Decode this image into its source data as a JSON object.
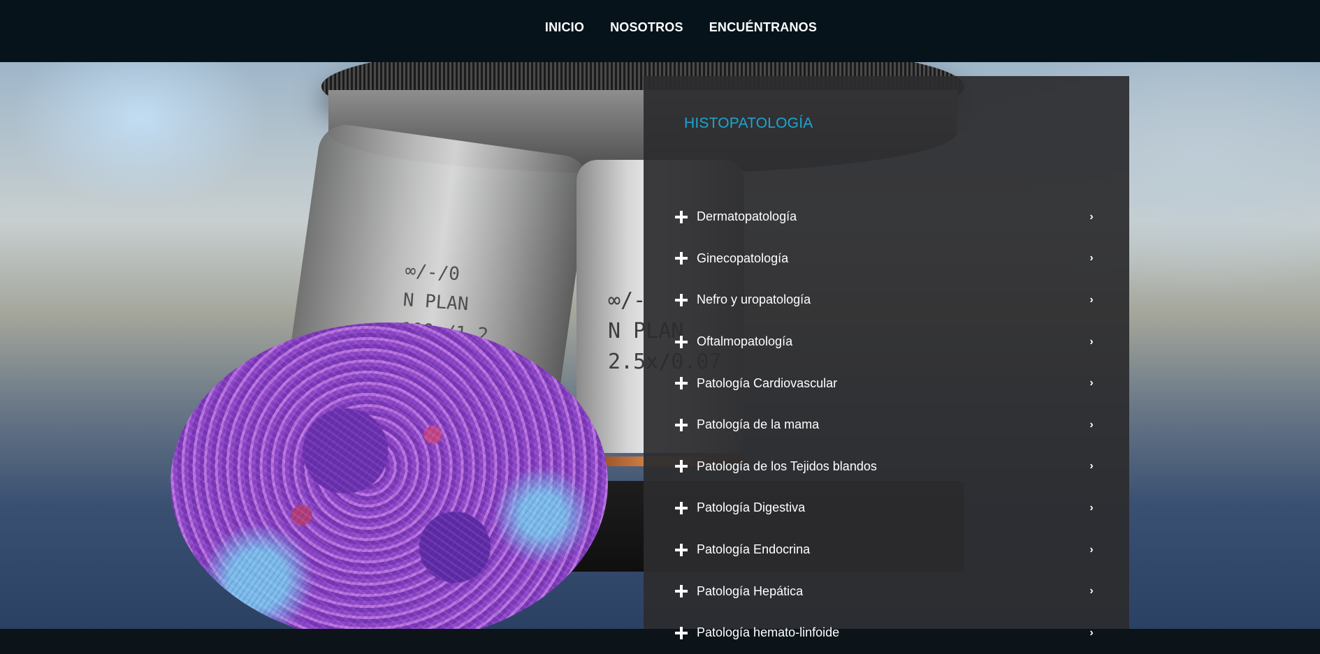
{
  "nav": {
    "items": [
      {
        "label": "INICIO"
      },
      {
        "label": "NOSOTROS"
      },
      {
        "label": "ENCUÉNTRANOS"
      }
    ]
  },
  "hero": {
    "objective_left_text": [
      "∞/-/0",
      "N PLAN",
      "100x/1.2"
    ],
    "objective_mid_text": [
      "∞/-",
      "N PLAN",
      "2.5x/0.07"
    ]
  },
  "panel": {
    "title": "HISTOPATOLOGÍA",
    "items": [
      {
        "label": "Dermatopatología"
      },
      {
        "label": "Ginecopatología"
      },
      {
        "label": "Nefro y uropatología"
      },
      {
        "label": "Oftalmopatología"
      },
      {
        "label": "Patología Cardiovascular"
      },
      {
        "label": "Patología de la mama"
      },
      {
        "label": "Patología de los Tejidos blandos"
      },
      {
        "label": "Patología Digestiva"
      },
      {
        "label": "Patología Endocrina"
      },
      {
        "label": "Patología Hepática"
      },
      {
        "label": "Patología hemato-linfoide"
      }
    ],
    "plus_icon": "plus-icon",
    "chevron_icon": "chevron-right-icon"
  },
  "colors": {
    "topbar": "#06131b",
    "panel": "#2c2c2e",
    "title_accent": "#1aa6d3",
    "text": "#ffffff"
  }
}
